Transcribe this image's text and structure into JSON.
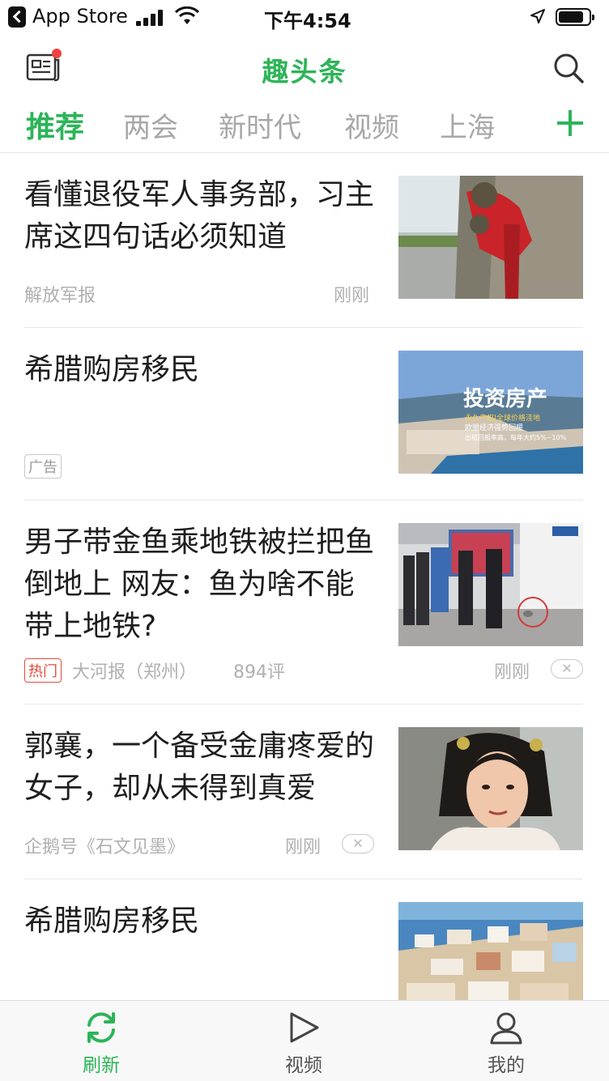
{
  "status_bar": {
    "back_app": "App Store",
    "time": "下午4:54"
  },
  "header": {
    "title": "趣头条"
  },
  "tabs": [
    {
      "label": "推荐",
      "active": true
    },
    {
      "label": "两会",
      "active": false
    },
    {
      "label": "新时代",
      "active": false
    },
    {
      "label": "视频",
      "active": false
    },
    {
      "label": "上海",
      "active": false
    }
  ],
  "feed": [
    {
      "headline": "看懂退役军人事务部，习主席这四句话必须知道",
      "source": "解放军报",
      "time": "刚刚"
    },
    {
      "headline": "希腊购房移民",
      "tag": "广告",
      "thumb_text": {
        "big": "投资房产",
        "line1": "永久产权|全球价格洼地",
        "line2": "欧盟经济强势回暖",
        "line3": "出租回报率高，每年大约5%~10%"
      }
    },
    {
      "headline": "男子带金鱼乘地铁被拦把鱼倒地上 网友：鱼为啥不能带上地铁?",
      "tag": "热门",
      "source": "大河报（郑州）",
      "comments": "894评",
      "time": "刚刚"
    },
    {
      "headline": "郭襄，一个备受金庸疼爱的女子，却从未得到真爱",
      "source": "企鹅号《石文见墨》",
      "time": "刚刚"
    },
    {
      "headline": "希腊购房移民"
    }
  ],
  "tabbar": [
    {
      "label": "刷新",
      "icon": "refresh-icon",
      "active": true
    },
    {
      "label": "视频",
      "icon": "play-icon",
      "active": false
    },
    {
      "label": "我的",
      "icon": "user-icon",
      "active": false
    }
  ],
  "colors": {
    "brand_green": "#2db458",
    "hot_red": "#e24a3b",
    "notify_dot": "#f04040"
  }
}
